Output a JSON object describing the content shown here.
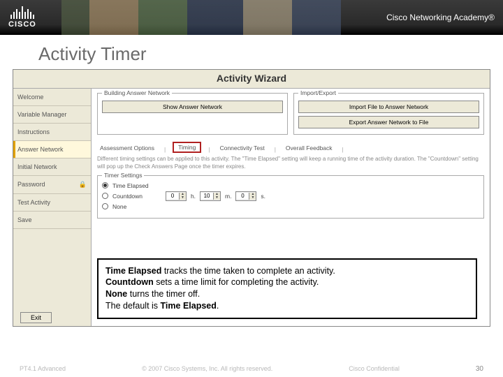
{
  "banner": {
    "logo_text": "CISCO",
    "academy": "Cisco Networking Academy®"
  },
  "slide": {
    "title": "Activity Timer"
  },
  "wizard": {
    "title": "Activity Wizard",
    "sidebar": {
      "items": [
        {
          "label": "Welcome"
        },
        {
          "label": "Variable Manager"
        },
        {
          "label": "Instructions"
        },
        {
          "label": "Answer Network"
        },
        {
          "label": "Initial Network"
        },
        {
          "label": "Password"
        },
        {
          "label": "Test Activity"
        },
        {
          "label": "Save"
        }
      ],
      "exit": "Exit"
    },
    "answer_group": {
      "legend": "Building Answer Network",
      "button": "Show Answer Network"
    },
    "import_group": {
      "legend": "Import/Export",
      "btn1": "Import File to Answer Network",
      "btn2": "Export Answer Network to File"
    },
    "tabs": {
      "t0": "Assessment Options",
      "t1": "Timing",
      "t2": "Connectivity Test",
      "t3": "Overall Feedback"
    },
    "desc": "Different timing settings can be applied to this activity. The \"Time Elapsed\" setting will keep a running time of the activity duration. The \"Countdown\" setting will pop up the Check Answers Page once the timer expires.",
    "timer": {
      "legend": "Timer Settings",
      "opt_elapsed": "Time Elapsed",
      "opt_countdown": "Countdown",
      "opt_none": "None",
      "h_label": "h.",
      "m_label": "m.",
      "s_label": "s.",
      "h_val": "0",
      "m_val": "10",
      "s_val": "0"
    }
  },
  "callout": {
    "l1a": "Time Elapsed",
    "l1b": " tracks the time taken to complete an activity.",
    "l2a": "Countdown",
    "l2b": " sets a time limit for completing the activity.",
    "l3a": "None ",
    "l3b": "turns the timer off.",
    "l4a": "The default is ",
    "l4b": "Time Elapsed",
    "l4c": "."
  },
  "footer": {
    "left": "PT4.1 Advanced",
    "center": "© 2007 Cisco Systems, Inc. All rights reserved.",
    "right": "Cisco Confidential",
    "page": "30"
  }
}
